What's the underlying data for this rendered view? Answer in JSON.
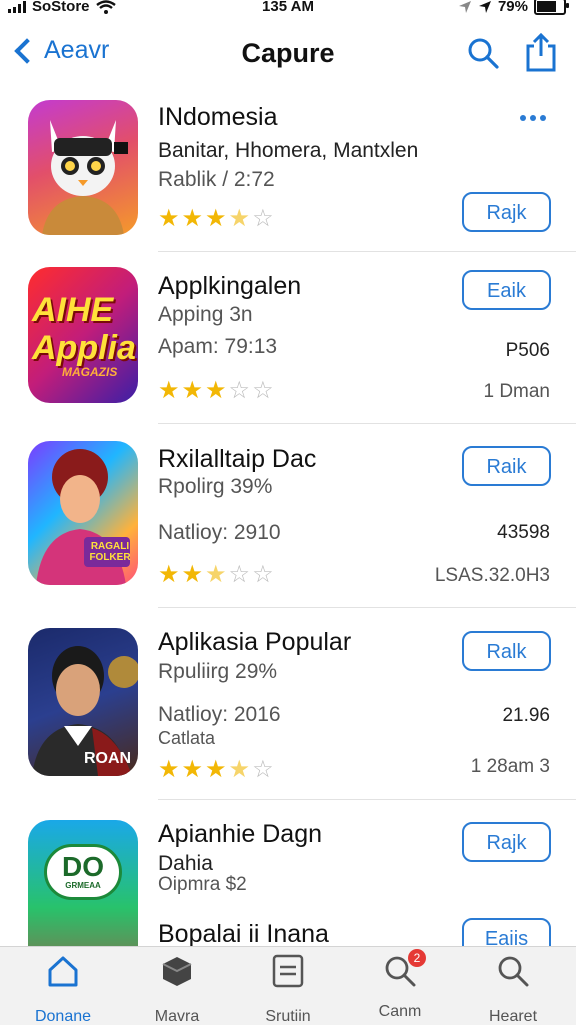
{
  "status": {
    "carrier": "SoStore",
    "time": "135 AM",
    "battery": "79%",
    "battery_level": 0.79
  },
  "nav": {
    "back_label": "Aeavr",
    "title": "Capure"
  },
  "apps": [
    {
      "title": "INdomesia",
      "line1": "Banitar, Hhomera, Mantxlen",
      "line2": "Rablik / 2:72",
      "rating": 3.5,
      "button": "Rajk"
    },
    {
      "title": "Applkingalen",
      "line1": "Apping 3n",
      "line2": "Apam: 79:13",
      "rating": 3,
      "button": "Eaik",
      "price": "P506",
      "downloads": "1 Dman",
      "icon_text": "AIHE Applia",
      "icon_sub": "MAGAZIS"
    },
    {
      "title": "Rxilalltaip Dac",
      "line1": "Rpolirg 39%",
      "line2": "Natlioy: 2910",
      "rating": 2.5,
      "button": "Raik",
      "price": "43598",
      "downloads": "LSAS.32.0H3",
      "icon_text": "RAGALI FOLKER"
    },
    {
      "title": "Aplikasia Popular",
      "line1": "Rpuliirg 29%",
      "line2": "Natlioy: 2016",
      "line3": "Catlata",
      "rating": 3.5,
      "button": "Ralk",
      "price": "21.96",
      "downloads": "1 28am 3",
      "icon_text": "ROAN"
    },
    {
      "title": "Apianhie Dagn",
      "line1": "Dahia",
      "line2": "Oipmra $2",
      "button": "Rajk",
      "icon_text": "DO",
      "icon_sub": "GRMEAA"
    },
    {
      "title": "Bopalai ii Inana",
      "button": "Eaiis"
    }
  ],
  "tabs": [
    {
      "label": "Donane",
      "icon": "home-icon"
    },
    {
      "label": "Mavra",
      "icon": "box-icon"
    },
    {
      "label": "Srutiin",
      "icon": "list-icon"
    },
    {
      "label": "Canm",
      "icon": "search-icon",
      "badge": "2"
    },
    {
      "label": "Hearet",
      "icon": "search-icon"
    }
  ],
  "colors": {
    "accent": "#1a73d1",
    "star": "#f2b705",
    "badge": "#e53935"
  }
}
